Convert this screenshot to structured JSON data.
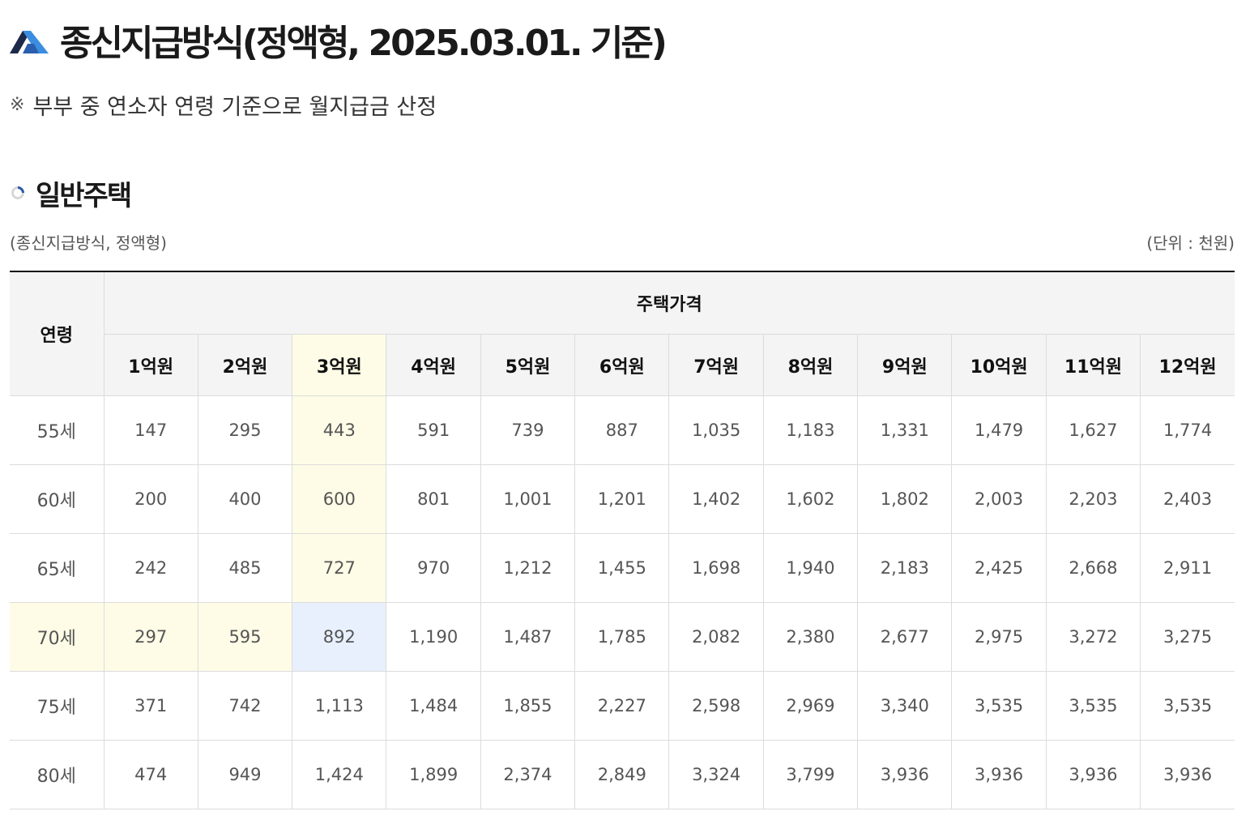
{
  "header": {
    "title": "종신지급방식(정액형, 2025.03.01. 기준)",
    "note_mark": "※",
    "note": "부부 중 연소자 연령 기준으로 월지급금 산정",
    "icon": "triangle-logo-icon"
  },
  "section": {
    "title": "일반주택",
    "icon": "ring-bullet-icon"
  },
  "captions": {
    "left": "(종신지급방식, 정액형)",
    "right": "(단위 : 천원)"
  },
  "table": {
    "age_header": "연령",
    "price_header": "주택가격",
    "columns": [
      "1억원",
      "2억원",
      "3억원",
      "4억원",
      "5억원",
      "6억원",
      "7억원",
      "8억원",
      "9억원",
      "10억원",
      "11억원",
      "12억원"
    ],
    "rows": [
      {
        "age": "55세",
        "values": [
          "147",
          "295",
          "443",
          "591",
          "739",
          "887",
          "1,035",
          "1,183",
          "1,331",
          "1,479",
          "1,627",
          "1,774"
        ]
      },
      {
        "age": "60세",
        "values": [
          "200",
          "400",
          "600",
          "801",
          "1,001",
          "1,201",
          "1,402",
          "1,602",
          "1,802",
          "2,003",
          "2,203",
          "2,403"
        ]
      },
      {
        "age": "65세",
        "values": [
          "242",
          "485",
          "727",
          "970",
          "1,212",
          "1,455",
          "1,698",
          "1,940",
          "2,183",
          "2,425",
          "2,668",
          "2,911"
        ]
      },
      {
        "age": "70세",
        "values": [
          "297",
          "595",
          "892",
          "1,190",
          "1,487",
          "1,785",
          "2,082",
          "2,380",
          "2,677",
          "2,975",
          "3,272",
          "3,275"
        ]
      },
      {
        "age": "75세",
        "values": [
          "371",
          "742",
          "1,113",
          "1,484",
          "1,855",
          "2,227",
          "2,598",
          "2,969",
          "3,340",
          "3,535",
          "3,535",
          "3,535"
        ]
      },
      {
        "age": "80세",
        "values": [
          "474",
          "949",
          "1,424",
          "1,899",
          "2,374",
          "2,849",
          "3,324",
          "3,799",
          "3,936",
          "3,936",
          "3,936",
          "3,936"
        ]
      }
    ],
    "highlight_column": 2,
    "highlight_row": 3
  },
  "colors": {
    "highlight_yellow": "#fefce6",
    "highlight_blue": "#e8f0fd",
    "header_bg": "#f4f4f4",
    "logo_dark": "#1e2a4a",
    "logo_blue": "#3b8de0"
  }
}
